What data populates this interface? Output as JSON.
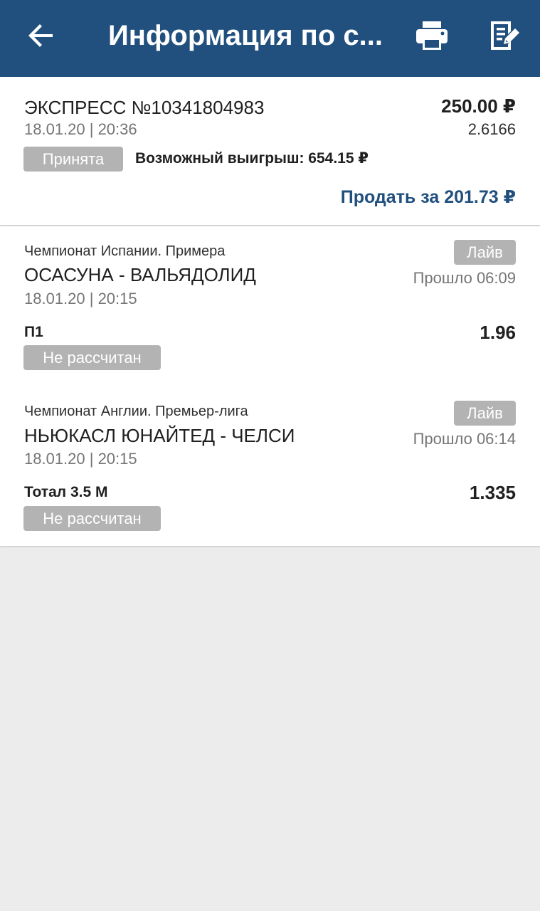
{
  "header": {
    "title": "Информация по с...",
    "background_color": "#21507f",
    "icons": [
      "back-arrow-icon",
      "print-icon",
      "edit-icon"
    ]
  },
  "bet": {
    "type_number": "ЭКСПРЕСС №10341804983",
    "stake": "250.00 ₽",
    "date": "18.01.20 | 20:36",
    "total_coef": "2.6166",
    "status": "Принята",
    "possible_win": "Возможный выигрыш: 654.15 ₽",
    "sell_label": "Продать за 201.73 ₽",
    "accent_color": "#21507f"
  },
  "events": [
    {
      "league": "Чемпионат Испании. Примера",
      "match": "ОСАСУНА - ВАЛЬЯДОЛИД",
      "date": "18.01.20 | 20:15",
      "live_badge": "Лайв",
      "elapsed": "Прошло 06:09",
      "outcome": "П1",
      "odds": "1.96",
      "result_status": "Не рассчитан"
    },
    {
      "league": "Чемпионат Англии. Премьер-лига",
      "match": "НЬЮКАСЛ ЮНАЙТЕД - ЧЕЛСИ",
      "date": "18.01.20 | 20:15",
      "live_badge": "Лайв",
      "elapsed": "Прошло 06:14",
      "outcome": "Тотал 3.5 М",
      "odds": "1.335",
      "result_status": "Не рассчитан"
    }
  ]
}
